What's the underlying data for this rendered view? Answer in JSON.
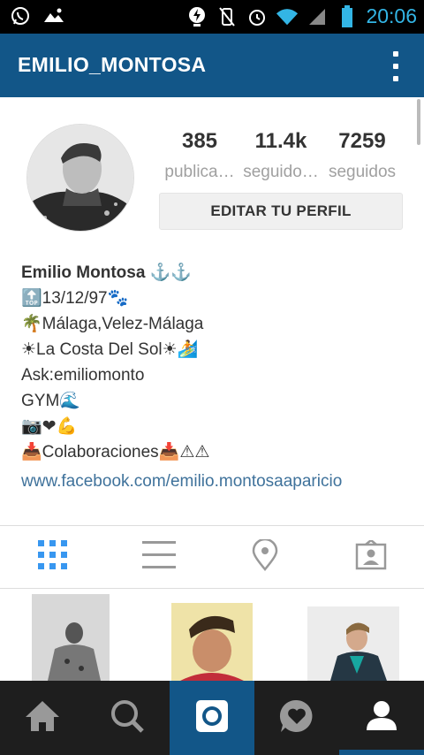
{
  "status_bar": {
    "time": "20:06",
    "icons": [
      "whatsapp-icon",
      "landscape-icon",
      "battery-saver-icon",
      "vibrate-off-icon",
      "alarm-icon",
      "wifi-icon",
      "signal-icon",
      "battery-icon"
    ]
  },
  "app_bar": {
    "title": "EMILIO_MONTOSA",
    "menu_icon": "overflow-menu-icon"
  },
  "profile": {
    "avatar": "profile-avatar",
    "stats": [
      {
        "value": "385",
        "label": "publica…"
      },
      {
        "value": "11.4k",
        "label": "seguido…"
      },
      {
        "value": "7259",
        "label": "seguidos"
      }
    ],
    "edit_button": "EDITAR TU PERFIL"
  },
  "bio": {
    "name": "Emilio Montosa ⚓⚓",
    "lines": [
      "🔝13/12/97🐾",
      "🌴Málaga,Velez-Málaga",
      "☀La Costa Del Sol☀🏄",
      "Ask:emiliomonto",
      "GYM🌊",
      "📷❤💪",
      "📥Colaboraciones📥⚠⚠"
    ],
    "link": "www.facebook.com/emilio.montosaaparicio"
  },
  "tabs": [
    {
      "name": "grid-view-tab",
      "icon": "grid-icon",
      "active": true
    },
    {
      "name": "list-view-tab",
      "icon": "list-icon",
      "active": false
    },
    {
      "name": "location-tab",
      "icon": "location-pin-icon",
      "active": false
    },
    {
      "name": "tagged-tab",
      "icon": "tagged-person-icon",
      "active": false
    }
  ],
  "bottom_nav": [
    {
      "name": "home",
      "icon": "home-icon"
    },
    {
      "name": "search",
      "icon": "search-icon"
    },
    {
      "name": "camera",
      "icon": "camera-icon"
    },
    {
      "name": "activity",
      "icon": "heart-bubble-icon"
    },
    {
      "name": "profile",
      "icon": "profile-icon"
    }
  ],
  "colors": {
    "appbar": "#125688",
    "status_text": "#33b5e5",
    "link": "#3f729b",
    "tab_active": "#3897f0",
    "nav_bg": "#1e1e1e"
  }
}
